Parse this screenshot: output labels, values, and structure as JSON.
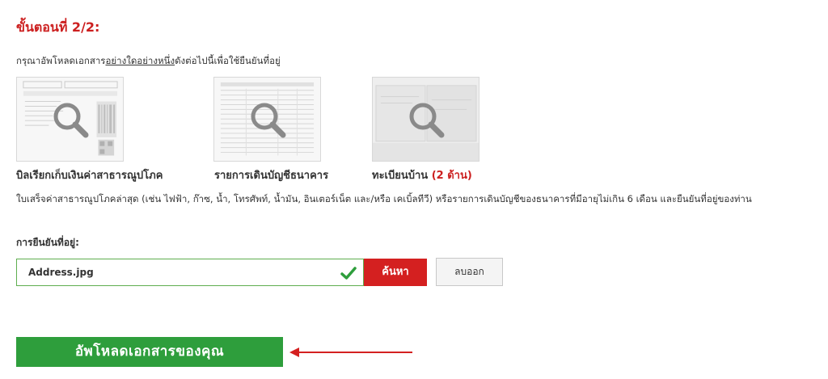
{
  "step": {
    "title": "ขั้นตอนที่ 2/2:"
  },
  "instruction": {
    "before": "กรุณาอัพโหลดเอกสาร",
    "underlined": "อย่างใดอย่างหนึ่ง",
    "after": "ดังต่อไปนี้เพื่อใช้ยืนยันที่อยู่"
  },
  "documents": [
    {
      "label": "บิลเรียกเก็บเงินค่าสาธารณูปโภค",
      "icon": "search-icon"
    },
    {
      "label": "รายการเดินบัญชีธนาคาร",
      "icon": "search-icon"
    },
    {
      "label": "ทะเบียนบ้าน ",
      "note": "(2 ด้าน)",
      "icon": "search-icon"
    }
  ],
  "description": "ใบเสร็จค่าสาธารณูปโภคล่าสุด (เช่น ไฟฟ้า, ก๊าซ, น้ำ, โทรศัพท์, น้ำมัน, อินเตอร์เน็ต และ/หรือ เคเบิ้ลทีวี) หรือรายการเดินบัญชีของธนาคารที่มีอายุไม่เกิน 6 เดือน และยืนยันที่อยู่ของท่าน",
  "form": {
    "label": "การยืนยันที่อยู่:",
    "file_name": "Address.jpg",
    "search_label": "ค้นหา",
    "remove_label": "ลบออก"
  },
  "upload": {
    "label": "อัพโหลดเอกสารของคุณ"
  },
  "colors": {
    "accent_red": "#d42020",
    "success_green": "#2e9e3c",
    "check_green": "#2e9e3c"
  }
}
